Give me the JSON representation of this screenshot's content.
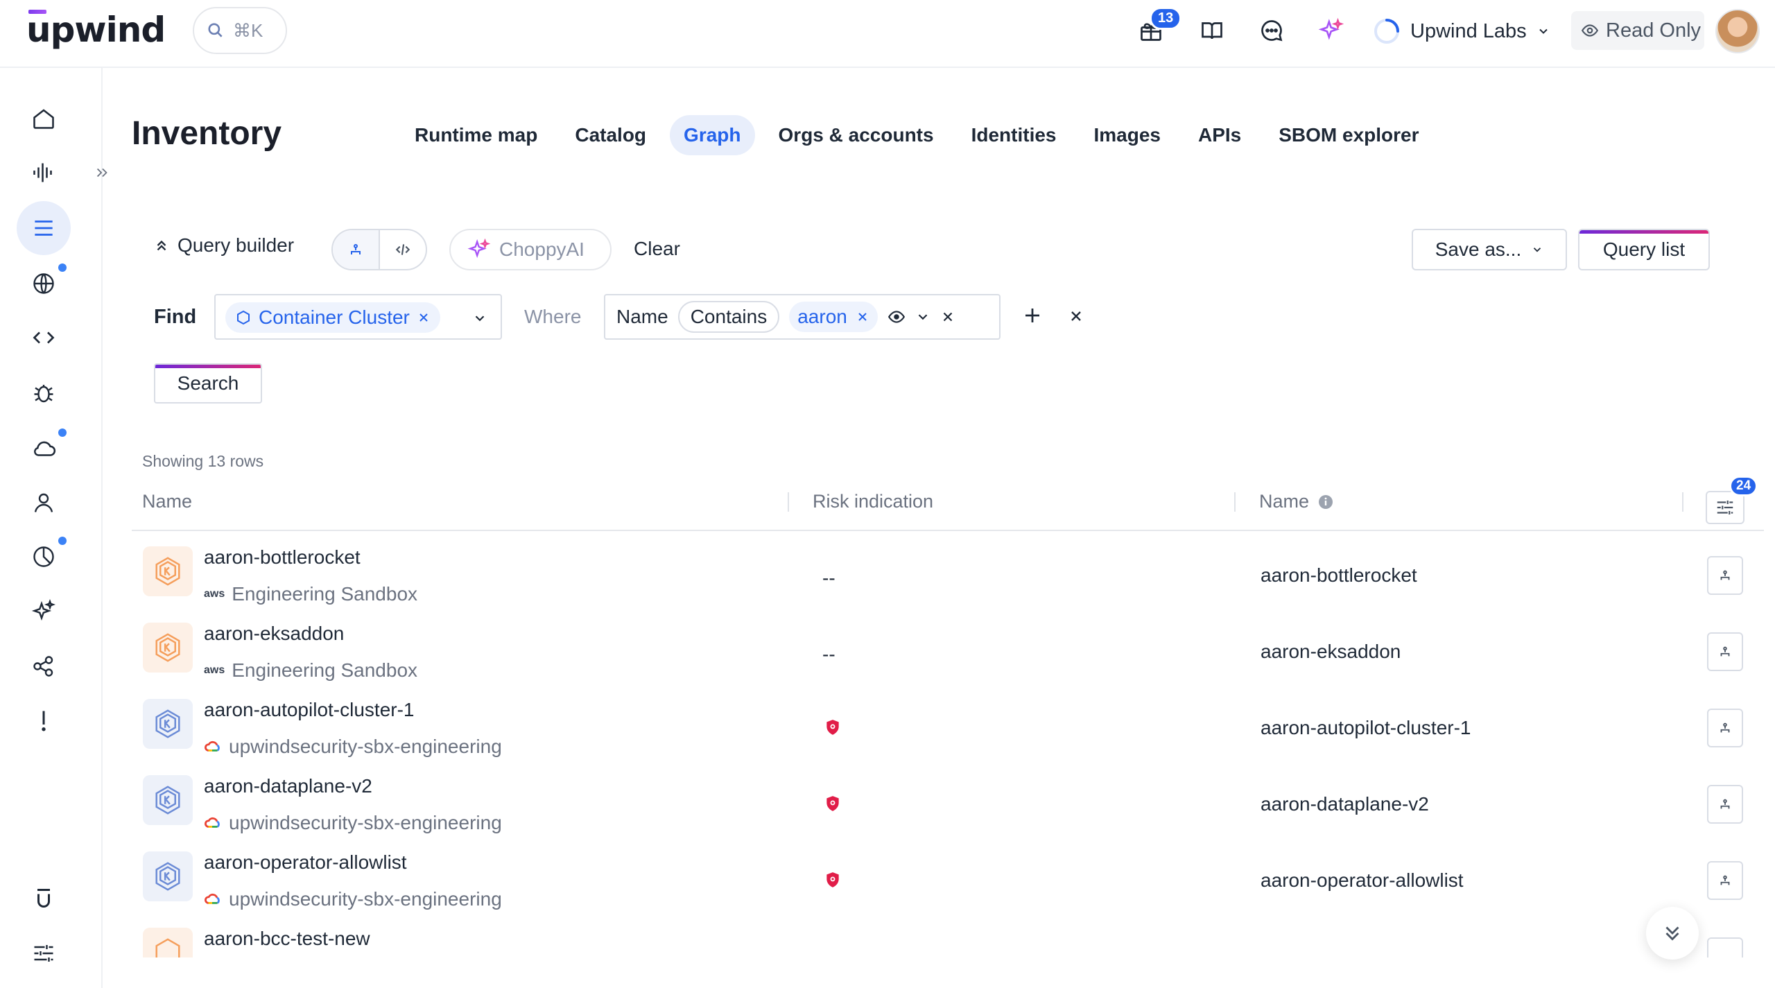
{
  "brand": {
    "logo_text": "upwind",
    "accent": "#2563eb"
  },
  "topbar": {
    "search_shortcut": "⌘K",
    "gift_badge": "13",
    "org_name": "Upwind Labs",
    "read_only_label": "Read Only"
  },
  "sidebar": {
    "items": [
      {
        "name": "home-icon"
      },
      {
        "name": "activity-icon"
      },
      {
        "name": "inventory-list-icon",
        "active": true
      },
      {
        "name": "globe-icon",
        "dot": true
      },
      {
        "name": "code-icon"
      },
      {
        "name": "bug-icon"
      },
      {
        "name": "cloud-icon",
        "dot": true
      },
      {
        "name": "user-icon"
      },
      {
        "name": "pie-chart-icon",
        "dot": true
      },
      {
        "name": "sparkle-icon"
      },
      {
        "name": "share-icon"
      },
      {
        "name": "alert-icon"
      }
    ],
    "bottom": [
      {
        "name": "upwind-mark-icon"
      },
      {
        "name": "settings-sliders-icon"
      }
    ]
  },
  "page": {
    "title": "Inventory",
    "tabs": [
      {
        "label": "Runtime map"
      },
      {
        "label": "Catalog"
      },
      {
        "label": "Graph",
        "active": true
      },
      {
        "label": "Orgs & accounts"
      },
      {
        "label": "Identities"
      },
      {
        "label": "Images"
      },
      {
        "label": "APIs"
      },
      {
        "label": "SBOM explorer"
      }
    ]
  },
  "query": {
    "builder_label": "Query builder",
    "ai_label": "ChoppyAI",
    "clear_label": "Clear",
    "save_as_label": "Save as...",
    "query_list_label": "Query list",
    "find_label": "Find",
    "find_value": "Container Cluster",
    "where_label": "Where",
    "condition": {
      "field": "Name",
      "operator": "Contains",
      "value": "aaron"
    },
    "search_label": "Search"
  },
  "table": {
    "showing": "Showing 13 rows",
    "columns": [
      "Name",
      "Risk indication",
      "Name"
    ],
    "column_count_badge": "24",
    "rows": [
      {
        "name": "aaron-bottlerocket",
        "sub": "Engineering Sandbox",
        "provider": "aws",
        "risk": "--",
        "name2": "aaron-bottlerocket",
        "icon": "orange"
      },
      {
        "name": "aaron-eksaddon",
        "sub": "Engineering Sandbox",
        "provider": "aws",
        "risk": "--",
        "name2": "aaron-eksaddon",
        "icon": "orange"
      },
      {
        "name": "aaron-autopilot-cluster-1",
        "sub": "upwindsecurity-sbx-engineering",
        "provider": "gcp",
        "risk": "",
        "name2": "aaron-autopilot-cluster-1",
        "icon": "blue"
      },
      {
        "name": "aaron-dataplane-v2",
        "sub": "upwindsecurity-sbx-engineering",
        "provider": "gcp",
        "risk": "",
        "name2": "aaron-dataplane-v2",
        "icon": "blue"
      },
      {
        "name": "aaron-operator-allowlist",
        "sub": "upwindsecurity-sbx-engineering",
        "provider": "gcp",
        "risk": "",
        "name2": "aaron-operator-allowlist",
        "icon": "blue"
      },
      {
        "name": "aaron-bcc-test-new",
        "sub": "",
        "provider": "",
        "risk": "",
        "name2": "",
        "icon": "orange"
      }
    ]
  }
}
